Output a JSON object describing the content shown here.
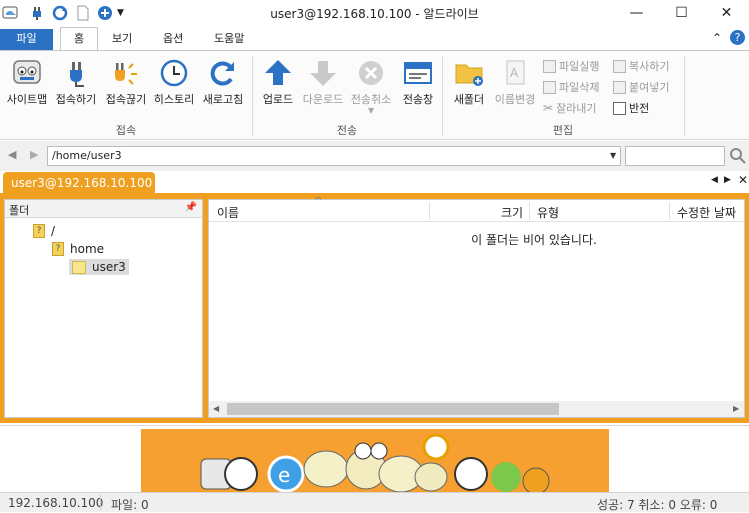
{
  "window": {
    "title": "user3@192.168.10.100 - 알드라이브",
    "minimize_glyph": "—",
    "maximize_glyph": "☐",
    "close_glyph": "✕"
  },
  "ribbon_tabs": [
    "파일",
    "홈",
    "보기",
    "옵션",
    "도움말"
  ],
  "ribbon": {
    "groups": {
      "connect": "접속",
      "transfer": "전송",
      "edit": "편집"
    },
    "connect_buttons": [
      "사이트맵",
      "접속하기",
      "접속끊기",
      "히스토리",
      "새로고침"
    ],
    "transfer_buttons": [
      "업로드",
      "다운로드",
      "전송취소",
      "전송창"
    ],
    "edit_large": [
      "새폴더",
      "이름변경"
    ],
    "edit_small": {
      "run_file": "파일실행",
      "delete_file": "파일삭제",
      "cut": "잘라내기",
      "copy": "복사하기",
      "paste": "붙여넣기",
      "invert": "반전"
    }
  },
  "address": {
    "path": "/home/user3",
    "search_placeholder": ""
  },
  "session_tab": "user3@192.168.10.100",
  "folder_pane": {
    "title": "폴더",
    "tree": [
      "/",
      "home",
      "user3"
    ]
  },
  "file_list": {
    "columns": [
      "이름",
      "크기",
      "유형",
      "수정한 날짜"
    ],
    "empty_message": "이 폴더는 비어 있습니다."
  },
  "status": {
    "host": "192.168.10.100",
    "files": "파일: 0",
    "summary": "성공: 7 취소: 0 오류: 0"
  },
  "colors": {
    "accent_blue": "#2b72c4",
    "session_orange": "#f0a020"
  }
}
